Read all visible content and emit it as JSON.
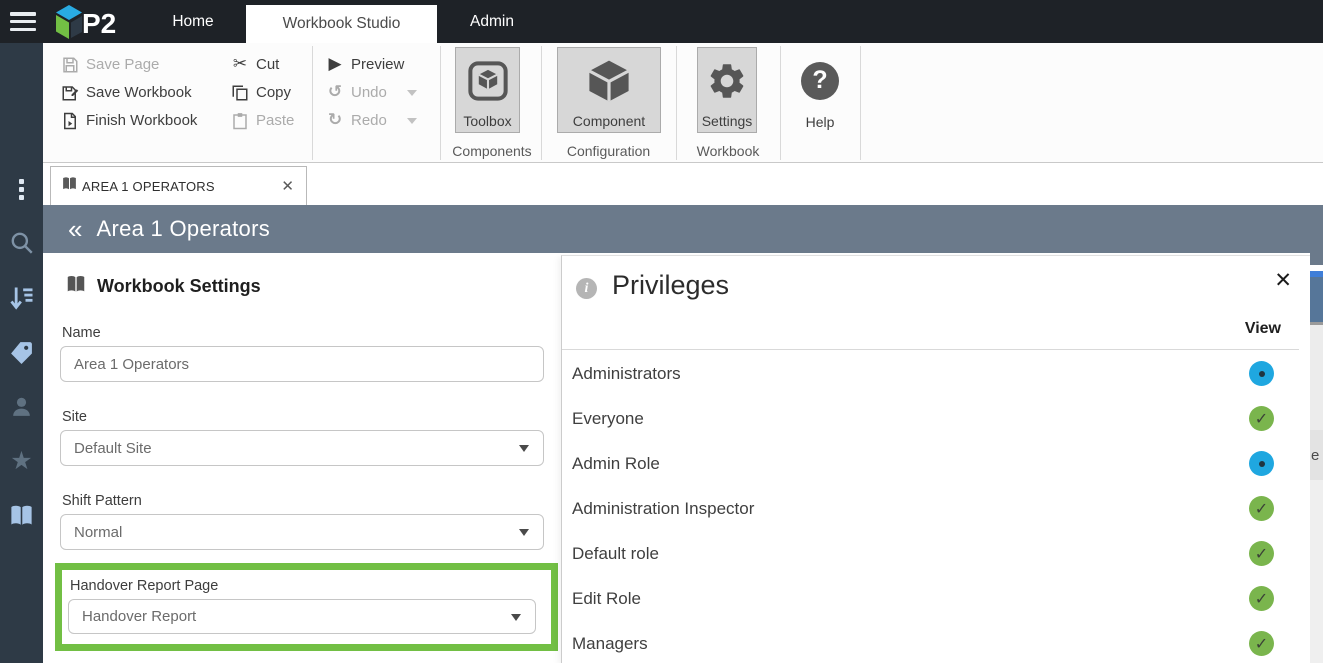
{
  "app": {
    "logo_text": "P2",
    "nav_tabs": [
      {
        "label": "Home",
        "active": false
      },
      {
        "label": "Workbook Studio",
        "active": true
      },
      {
        "label": "Admin",
        "active": false
      }
    ]
  },
  "ribbon": {
    "file_group": [
      {
        "label": "Save Page",
        "disabled": true
      },
      {
        "label": "Save Workbook",
        "disabled": false
      },
      {
        "label": "Finish Workbook",
        "disabled": false
      }
    ],
    "clipboard_group": [
      {
        "label": "Cut",
        "disabled": false
      },
      {
        "label": "Copy",
        "disabled": false
      },
      {
        "label": "Paste",
        "disabled": true
      }
    ],
    "action_group": [
      {
        "label": "Preview",
        "disabled": false,
        "dropdown": false
      },
      {
        "label": "Undo",
        "disabled": true,
        "dropdown": true
      },
      {
        "label": "Redo",
        "disabled": true,
        "dropdown": true
      }
    ],
    "big_buttons": [
      {
        "label": "Toolbox",
        "group_label": "Components"
      },
      {
        "label": "Component",
        "group_label": "Configuration"
      },
      {
        "label": "Settings",
        "group_label": "Workbook"
      },
      {
        "label": "Help",
        "group_label": ""
      }
    ]
  },
  "icons": {
    "cut": "✂",
    "preview": "▶",
    "undo": "↺",
    "redo": "↻",
    "star": "★",
    "help": "?",
    "info": "i",
    "close": "✕"
  },
  "workbook_tab": {
    "label": "AREA 1 OPERATORS"
  },
  "page_header": {
    "collapse_glyph": "«",
    "title": "Area 1 Operators"
  },
  "workbook_settings": {
    "title": "Workbook Settings",
    "fields": [
      {
        "label": "Name",
        "value": "Area 1 Operators",
        "type": "text",
        "highlighted": false
      },
      {
        "label": "Site",
        "value": "Default Site",
        "type": "select",
        "highlighted": false
      },
      {
        "label": "Shift Pattern",
        "value": "Normal",
        "type": "select",
        "highlighted": false
      },
      {
        "label": "Handover Report Page",
        "value": "Handover Report",
        "type": "select",
        "highlighted": true
      }
    ]
  },
  "privileges": {
    "title": "Privileges",
    "column_header": "View",
    "rows": [
      {
        "name": "Administrators",
        "view": "partial"
      },
      {
        "name": "Everyone",
        "view": "allowed"
      },
      {
        "name": "Admin Role",
        "view": "partial"
      },
      {
        "name": "Administration Inspector",
        "view": "allowed"
      },
      {
        "name": "Default role",
        "view": "allowed"
      },
      {
        "name": "Edit Role",
        "view": "allowed"
      },
      {
        "name": "Managers",
        "view": "allowed"
      }
    ]
  },
  "background_sliver": {
    "partial_text": "e"
  },
  "colors": {
    "highlight_green": "#72bf44",
    "allowed_green": "#7ab54d",
    "partial_blue": "#1fa7e0",
    "header_slate": "#6b7a8b",
    "nav_dark": "#1e2227",
    "sidebar_dark": "#2e3a46"
  }
}
